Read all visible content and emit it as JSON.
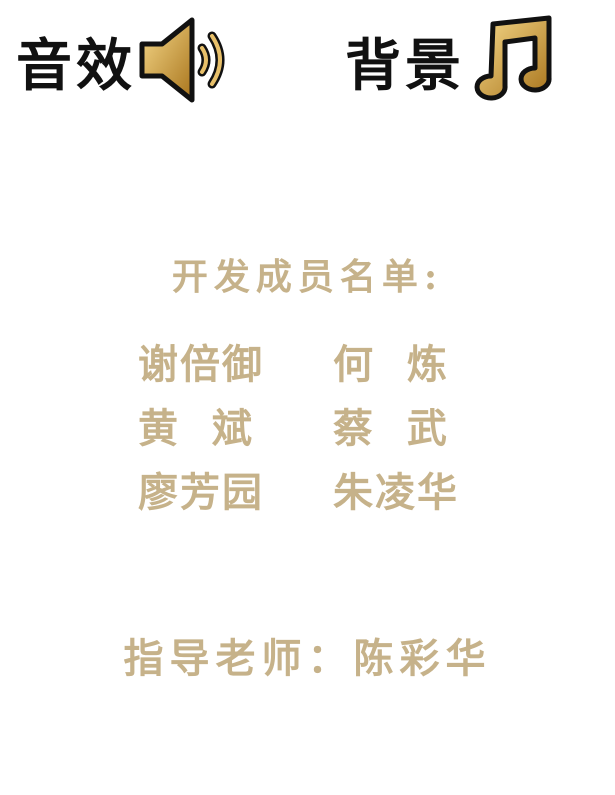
{
  "top_bar": {
    "sound": {
      "label": "音效",
      "icon": "speaker-volume-icon"
    },
    "music": {
      "label": "背景",
      "icon": "music-note-icon"
    }
  },
  "credits": {
    "title": "开发成员名单:",
    "rows": [
      {
        "left": "谢倍御",
        "right": "何  炼"
      },
      {
        "left": "黄  斌",
        "right": "蔡  武"
      },
      {
        "left": "廖芳园",
        "right": "朱凌华"
      }
    ],
    "advisor": "指导老师：陈彩华"
  },
  "colors": {
    "gold_text": "#c6b28a",
    "icon_gold_light": "#f4d27a",
    "icon_gold_dark": "#b07a1e",
    "black": "#111111"
  }
}
